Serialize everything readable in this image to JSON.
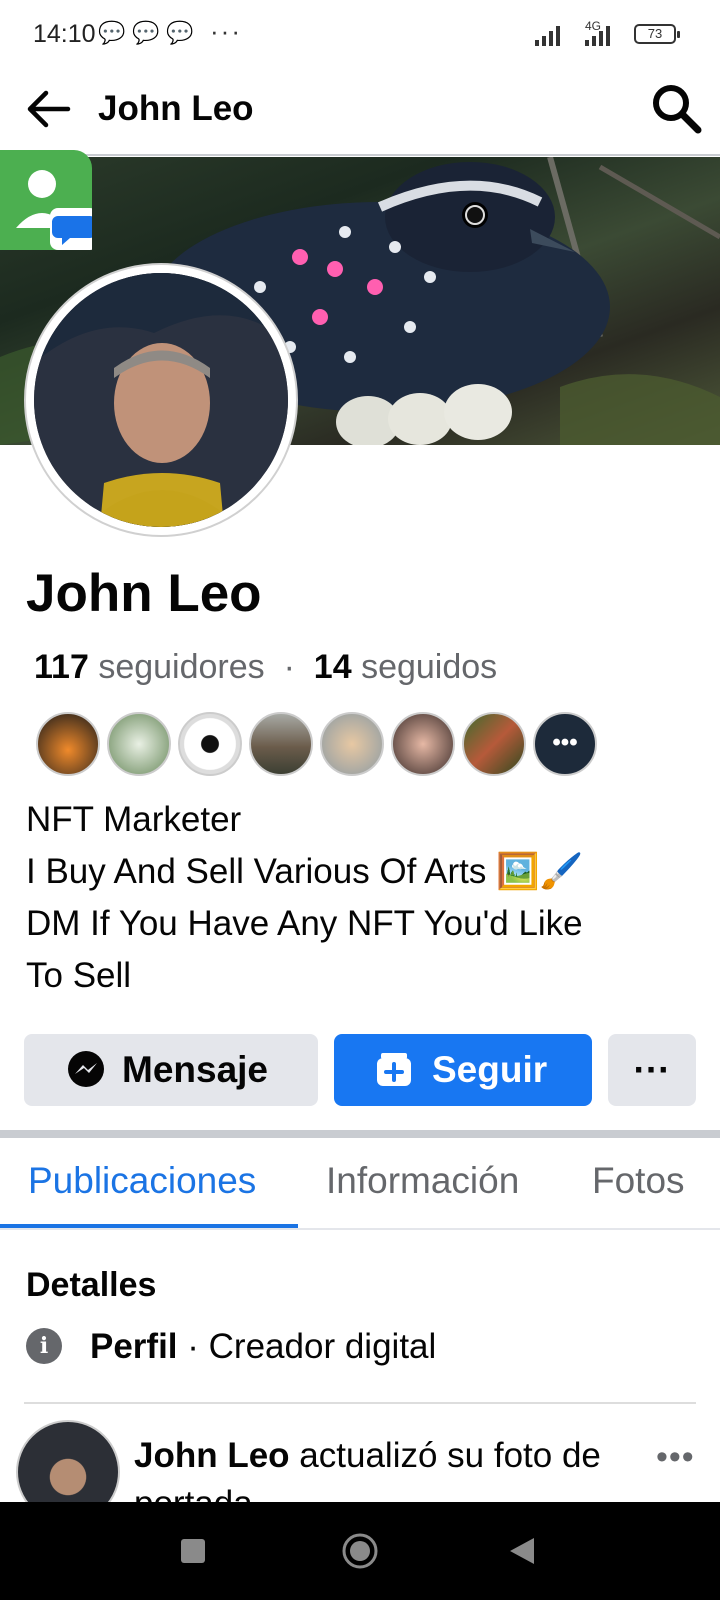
{
  "status_bar": {
    "time": "14:10",
    "battery": "73",
    "network": "4G"
  },
  "header": {
    "title": "John Leo"
  },
  "profile": {
    "name": "John Leo",
    "followers_count": "117",
    "followers_label": "seguidores",
    "separator": "·",
    "following_count": "14",
    "following_label": "seguidos",
    "bio": [
      "NFT Marketer",
      "I Buy And Sell Various Of Arts 🖼️🖌️",
      "DM If You Have Any NFT You'd Like",
      "To Sell"
    ]
  },
  "actions": {
    "message_label": "Mensaje",
    "follow_label": "Seguir",
    "more_label": "···"
  },
  "tabs": {
    "items": [
      "Publicaciones",
      "Información",
      "Fotos"
    ],
    "active": "Publicaciones"
  },
  "details": {
    "title": "Detalles",
    "profile_type_label": "Perfil",
    "profile_type_value": "· Creador digital"
  },
  "post": {
    "author": "John Leo",
    "action_text": "actualizó su foto de portada."
  },
  "colors": {
    "accent": "#1877f2",
    "tab_active": "#1b74e4",
    "secondary_text": "#65676b",
    "button_gray": "#e4e6eb"
  }
}
